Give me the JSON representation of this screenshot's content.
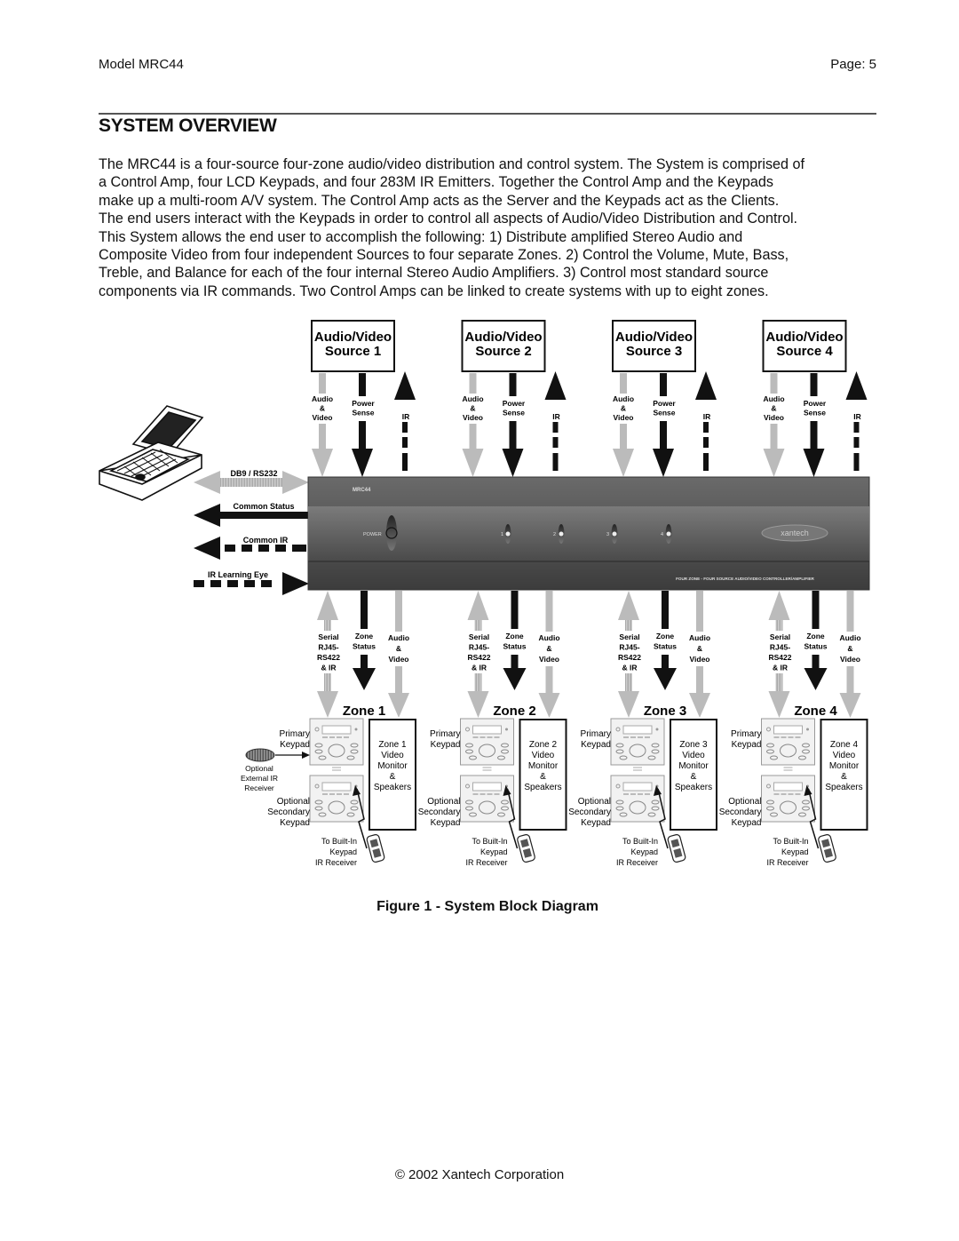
{
  "header": {
    "model": "Model MRC44",
    "page": "Page: 5"
  },
  "section_title": "SYSTEM OVERVIEW",
  "paragraph_lines": [
    "The MRC44 is a four-source four-zone audio/video distribution and control system. The System is comprised of",
    "a Control Amp, four LCD Keypads, and four 283M IR Emitters. Together the Control Amp and the Keypads",
    "make up a multi-room A/V system. The Control Amp acts as the Server and the Keypads act as the Clients.",
    "The end users interact with the Keypads in order to control all aspects of Audio/Video Distribution and Control.",
    "This System allows the end user to accomplish the following: 1) Distribute amplified Stereo Audio and",
    "Composite Video from four independent Sources to four separate Zones. 2) Control the Volume, Mute, Bass,",
    "Treble, and Balance for each of the four internal Stereo Audio Amplifiers. 3) Control most standard source",
    "components via IR commands. Two Control Amps can be linked to create systems with up to eight zones."
  ],
  "diagram": {
    "sources": [
      {
        "line1": "Audio/Video",
        "line2": "Source 1"
      },
      {
        "line1": "Audio/Video",
        "line2": "Source 2"
      },
      {
        "line1": "Audio/Video",
        "line2": "Source 3"
      },
      {
        "line1": "Audio/Video",
        "line2": "Source 4"
      }
    ],
    "source_signals": {
      "av": [
        "Audio",
        "&",
        "Video"
      ],
      "power": [
        "Power",
        "Sense"
      ],
      "ir": "IR"
    },
    "pc_links": {
      "db9": "DB9 / RS232",
      "common_status": "Common Status",
      "common_ir": "Common IR",
      "ir_eye": "IR Learning Eye"
    },
    "amp": {
      "model": "MRC44",
      "power_label": "POWER",
      "zone_leds": [
        "1",
        "2",
        "3",
        "4"
      ],
      "brand": "xantech",
      "description": "FOUR ZONE - FOUR SOURCE AUDIO/VIDEO CONTROLLER/AMPLIFIER"
    },
    "zone_signals": {
      "serial": [
        "Serial",
        "RJ45-",
        "RS422",
        "& IR"
      ],
      "status": [
        "Zone",
        "Status"
      ],
      "av": [
        "Audio",
        "&",
        "Video"
      ]
    },
    "zones": [
      {
        "title": "Zone 1",
        "monitor": [
          "Zone 1",
          "Video",
          "Monitor",
          "&",
          "Speakers"
        ]
      },
      {
        "title": "Zone 2",
        "monitor": [
          "Zone 2",
          "Video",
          "Monitor",
          "&",
          "Speakers"
        ]
      },
      {
        "title": "Zone 3",
        "monitor": [
          "Zone 3",
          "Video",
          "Monitor",
          "&",
          "Speakers"
        ]
      },
      {
        "title": "Zone 4",
        "monitor": [
          "Zone 4",
          "Video",
          "Monitor",
          "&",
          "Speakers"
        ]
      }
    ],
    "keypad_labels": {
      "primary": [
        "Primary",
        "Keypad"
      ],
      "secondary": [
        "Optional",
        "Secondary",
        "Keypad"
      ],
      "remote": [
        "To Built-In",
        "Keypad",
        "IR Receiver"
      ],
      "ext_ir": [
        "Optional",
        "External IR",
        "Receiver"
      ]
    }
  },
  "caption": "Figure 1 - System Block Diagram",
  "footer": "© 2002 Xantech Corporation"
}
